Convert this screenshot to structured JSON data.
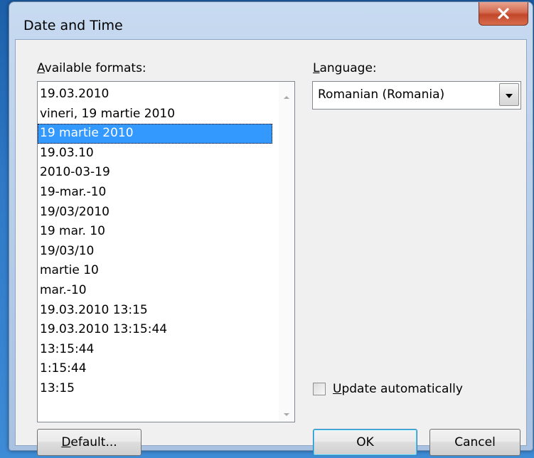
{
  "window": {
    "title": "Date and Time"
  },
  "formats": {
    "label": "Available formats:",
    "label_mnemonic": "A",
    "label_rest": "vailable formats:",
    "selected_index": 2,
    "items": [
      "19.03.2010",
      "vineri, 19 martie 2010",
      "19 martie 2010",
      "19.03.10",
      "2010-03-19",
      "19-mar.-10",
      "19/03/2010",
      "19 mar. 10",
      "19/03/10",
      "martie 10",
      "mar.-10",
      "19.03.2010 13:15",
      "19.03.2010 13:15:44",
      "13:15:44",
      "1:15:44",
      "13:15"
    ]
  },
  "language": {
    "label": "Language:",
    "label_mnemonic": "L",
    "label_rest": "anguage:",
    "value": "Romanian (Romania)"
  },
  "update_auto": {
    "label": "Update automatically",
    "label_mnemonic": "U",
    "label_rest": "pdate automatically",
    "checked": false
  },
  "buttons": {
    "default_mnemonic": "D",
    "default_rest": "efault...",
    "default_label": "Default...",
    "ok_label": "OK",
    "cancel_label": "Cancel"
  },
  "icons": {
    "close": "close-icon",
    "scroll_up": "scroll-up-arrow-icon",
    "scroll_down": "scroll-down-arrow-icon",
    "dropdown": "dropdown-arrow-icon"
  }
}
